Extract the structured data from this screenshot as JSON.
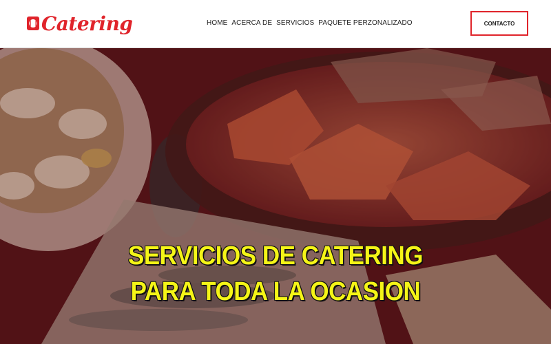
{
  "header": {
    "logo_text": "Catering",
    "nav": [
      {
        "label": "HOME"
      },
      {
        "label": "ACERCA DE"
      },
      {
        "label": "SERVICIOS"
      },
      {
        "label": "PAQUETE PERZONALIZADO"
      }
    ],
    "contact_label": "CONTACTO"
  },
  "hero": {
    "title_line1": "SERVICIOS DE CATERING",
    "title_line2": "PARA TODA LA OCASION"
  },
  "colors": {
    "accent": "#e0242b",
    "title": "#f5f517",
    "overlay": "#5a1418"
  }
}
